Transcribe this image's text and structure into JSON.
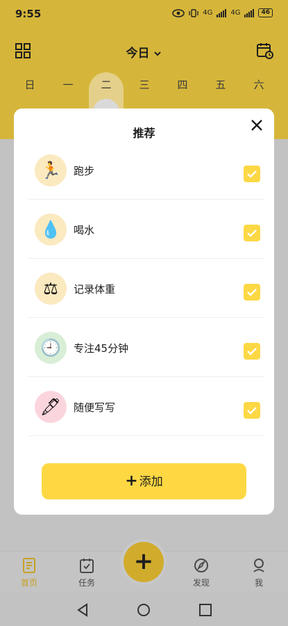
{
  "status_bar": {
    "time": "9:55",
    "battery": "46",
    "net1": "4G",
    "net2": "4G"
  },
  "header": {
    "title": "今日"
  },
  "weekdays": [
    "日",
    "一",
    "二",
    "三",
    "四",
    "五",
    "六"
  ],
  "selected_weekday": "二",
  "modal": {
    "title": "推荐",
    "items": [
      {
        "label": "跑步",
        "icon": "runner-icon",
        "glyph": "🏃",
        "checked": true,
        "bg": "#fbe9c0"
      },
      {
        "label": "喝水",
        "icon": "water-drop-icon",
        "glyph": "💧",
        "checked": true,
        "bg": "#fbe9c0"
      },
      {
        "label": "记录体重",
        "icon": "scale-icon",
        "glyph": "⚖",
        "checked": true,
        "bg": "#fbe9c0"
      },
      {
        "label": "专注45分钟",
        "icon": "clock-icon",
        "glyph": "🕘",
        "checked": true,
        "bg": "#d9eed7"
      },
      {
        "label": "随便写写",
        "icon": "pen-icon",
        "glyph": "🖋",
        "checked": true,
        "bg": "#fbd5dd"
      }
    ],
    "add_label": "添加"
  },
  "tabbar": {
    "home": "首页",
    "tasks": "任务",
    "discover": "发现",
    "me": "我"
  },
  "colors": {
    "accent": "#fdd843",
    "top_bar": "#d6b63a",
    "active_tab": "#c6a224"
  }
}
